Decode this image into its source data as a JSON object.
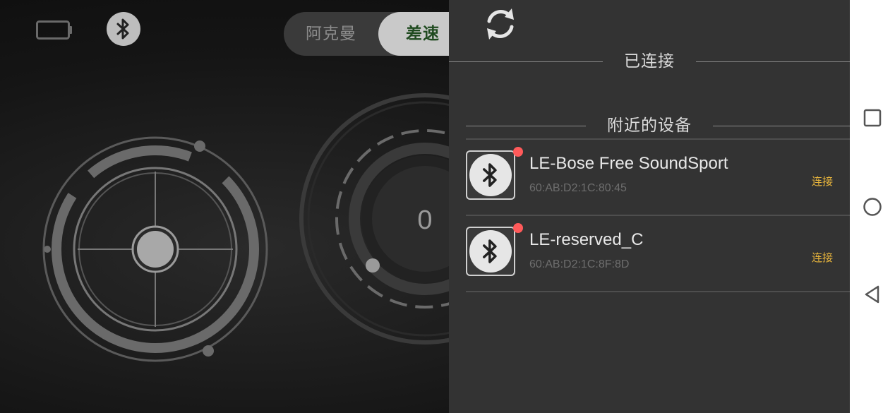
{
  "status": {
    "battery_icon": "battery-empty-icon",
    "bluetooth_icon": "bluetooth-icon"
  },
  "mode_toggle": {
    "options": [
      "阿克曼",
      "差速"
    ],
    "selected": "差速"
  },
  "speed_knob": {
    "value": "0"
  },
  "bt_panel": {
    "refresh_icon": "refresh-icon",
    "connected_title": "已连接",
    "nearby_title": "附近的设备",
    "devices": [
      {
        "name": "LE-Bose Free SoundSport",
        "mac": "60:AB:D2:1C:80:45",
        "action": "连接"
      },
      {
        "name": "LE-reserved_C",
        "mac": "60:AB:D2:1C:8F:8D",
        "action": "连接"
      }
    ]
  },
  "nav_bar": {
    "icons": [
      "recent-apps-icon",
      "home-icon",
      "back-icon"
    ]
  },
  "colors": {
    "panel_bg": "#333333",
    "connect_text": "#e8b53c",
    "status_dot": "#ff5a5a",
    "selected_mode_text": "#1f4a1f"
  }
}
